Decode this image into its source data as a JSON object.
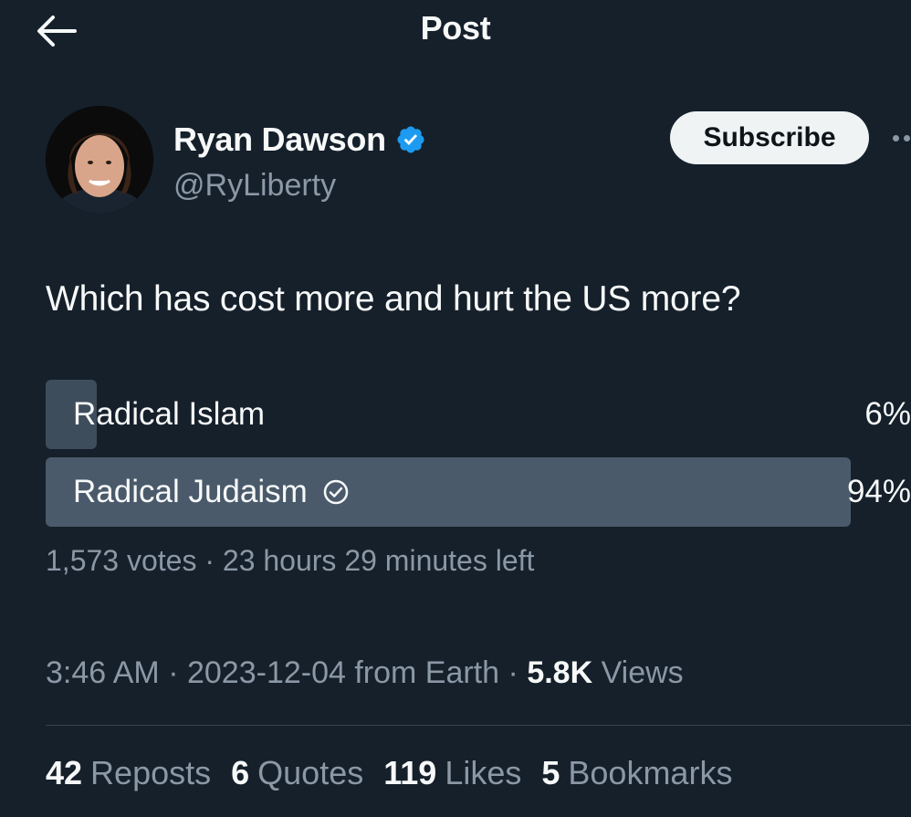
{
  "header": {
    "title": "Post",
    "back_icon": "arrow-left-icon"
  },
  "author": {
    "name": "Ryan Dawson",
    "handle": "@RyLiberty",
    "verified": true,
    "verified_color": "#1d9bf0",
    "subscribe_label": "Subscribe"
  },
  "post": {
    "text": "Which has cost more and hurt the US more?"
  },
  "poll": {
    "options": [
      {
        "label": "Radical Islam",
        "percent_label": "6%",
        "percent": 6,
        "selected": false
      },
      {
        "label": "Radical Judaism",
        "percent_label": "94%",
        "percent": 94,
        "selected": true
      }
    ],
    "votes": "1,573 votes",
    "separator": "·",
    "time_left": "23 hours 29 minutes left"
  },
  "meta": {
    "time": "3:46 AM",
    "date": "2023-12-04",
    "location": "from Earth",
    "views_count": "5.8K",
    "views_label": "Views"
  },
  "stats": {
    "reposts_count": "42",
    "reposts_label": "Reposts",
    "quotes_count": "6",
    "quotes_label": "Quotes",
    "likes_count": "119",
    "likes_label": "Likes",
    "bookmarks_count": "5",
    "bookmarks_label": "Bookmarks"
  },
  "colors": {
    "background": "#15202b",
    "text_primary": "#f7f9f9",
    "text_secondary": "#8b98a5",
    "poll_fill": "#3e4d5c",
    "button_bg": "#eff3f4"
  }
}
